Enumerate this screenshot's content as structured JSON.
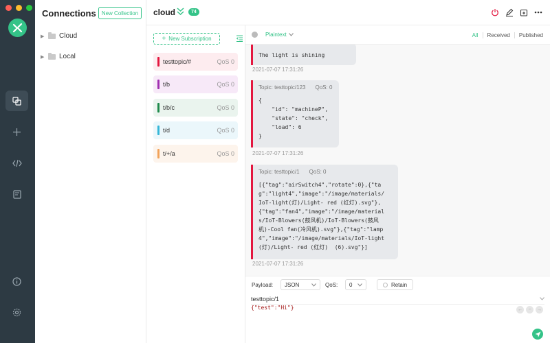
{
  "colors": {
    "accent": "#34c388",
    "message_bar": "#e3173f",
    "rail_bg": "#2d3a43"
  },
  "window": {
    "traffic_lights": [
      "#ff5f57",
      "#febc2e",
      "#28c840"
    ]
  },
  "rail": {
    "items": [
      {
        "icon": "connections-icon",
        "active": true
      },
      {
        "icon": "plus-icon",
        "active": false
      },
      {
        "icon": "code-icon",
        "active": false
      },
      {
        "icon": "log-icon",
        "active": false
      },
      {
        "icon": "info-icon",
        "active": false
      },
      {
        "icon": "gear-icon",
        "active": false
      }
    ]
  },
  "connections": {
    "title": "Connections",
    "new_collection_label": "New Collection",
    "folders": [
      {
        "name": "Cloud"
      },
      {
        "name": "Local"
      }
    ]
  },
  "header": {
    "name": "cloud",
    "count": "74",
    "icons": [
      "power-icon",
      "edit-icon",
      "new-window-icon",
      "more-icon"
    ]
  },
  "subscriptions": {
    "new_label": "New Subscription",
    "items": [
      {
        "topic": "testtopic/#",
        "qos": "QoS 0",
        "color": "#e3173f",
        "bg": "#fdecef"
      },
      {
        "topic": "t/b",
        "qos": "QoS 0",
        "color": "#a12fb1",
        "bg": "#f7e9f8"
      },
      {
        "topic": "t/b/c",
        "qos": "QoS 0",
        "color": "#1f8a4c",
        "bg": "#eaf4ee"
      },
      {
        "topic": "t/d",
        "qos": "QoS 0",
        "color": "#36b7d8",
        "bg": "#ebf7fb"
      },
      {
        "topic": "t/+/a",
        "qos": "QoS 0",
        "color": "#f2a35a",
        "bg": "#fdf4ec"
      }
    ]
  },
  "toolbar": {
    "format": "Plaintext",
    "filters": [
      "All",
      "Received",
      "Published"
    ],
    "active_filter": "All"
  },
  "messages": [
    {
      "topic": "",
      "qos": "",
      "payload": "The light is shining",
      "time": "2021-07-07 17:31:26"
    },
    {
      "topic": "Topic: testtopic/123",
      "qos": "QoS: 0",
      "payload": "{\n    \"id\": \"machineP\",\n    \"state\": \"check\",\n    \"load\": 6\n}",
      "time": "2021-07-07 17:31:26"
    },
    {
      "topic": "Topic: testtopic/1",
      "qos": "QoS: 0",
      "payload": "[{\"tag\":\"airSwitch4\",\"rotate\":0},{\"ta\ng\":\"light4\",\"image\":\"/image/materials/\nIoT-light(灯)/Light- red (红灯).svg\"},\n{\"tag\":\"fan4\",\"image\":\"/image/material\ns/IoT-Blowers(鼓风机)/IoT-Blowers(鼓风\n机)-Cool fan(冷风机).svg\"},{\"tag\":\"lamp\n4\",\"image\":\"/image/materials/IoT-light\n(灯)/Light- red (红灯)  (6).svg\"}]",
      "time": "2021-07-07 17:31:26"
    }
  ],
  "publish": {
    "payload_label": "Payload:",
    "payload_format": "JSON",
    "qos_label": "QoS:",
    "qos_value": "0",
    "retain_label": "Retain",
    "topic": "testtopic/1",
    "payload": "{\"test\":\"Hi\"}"
  }
}
